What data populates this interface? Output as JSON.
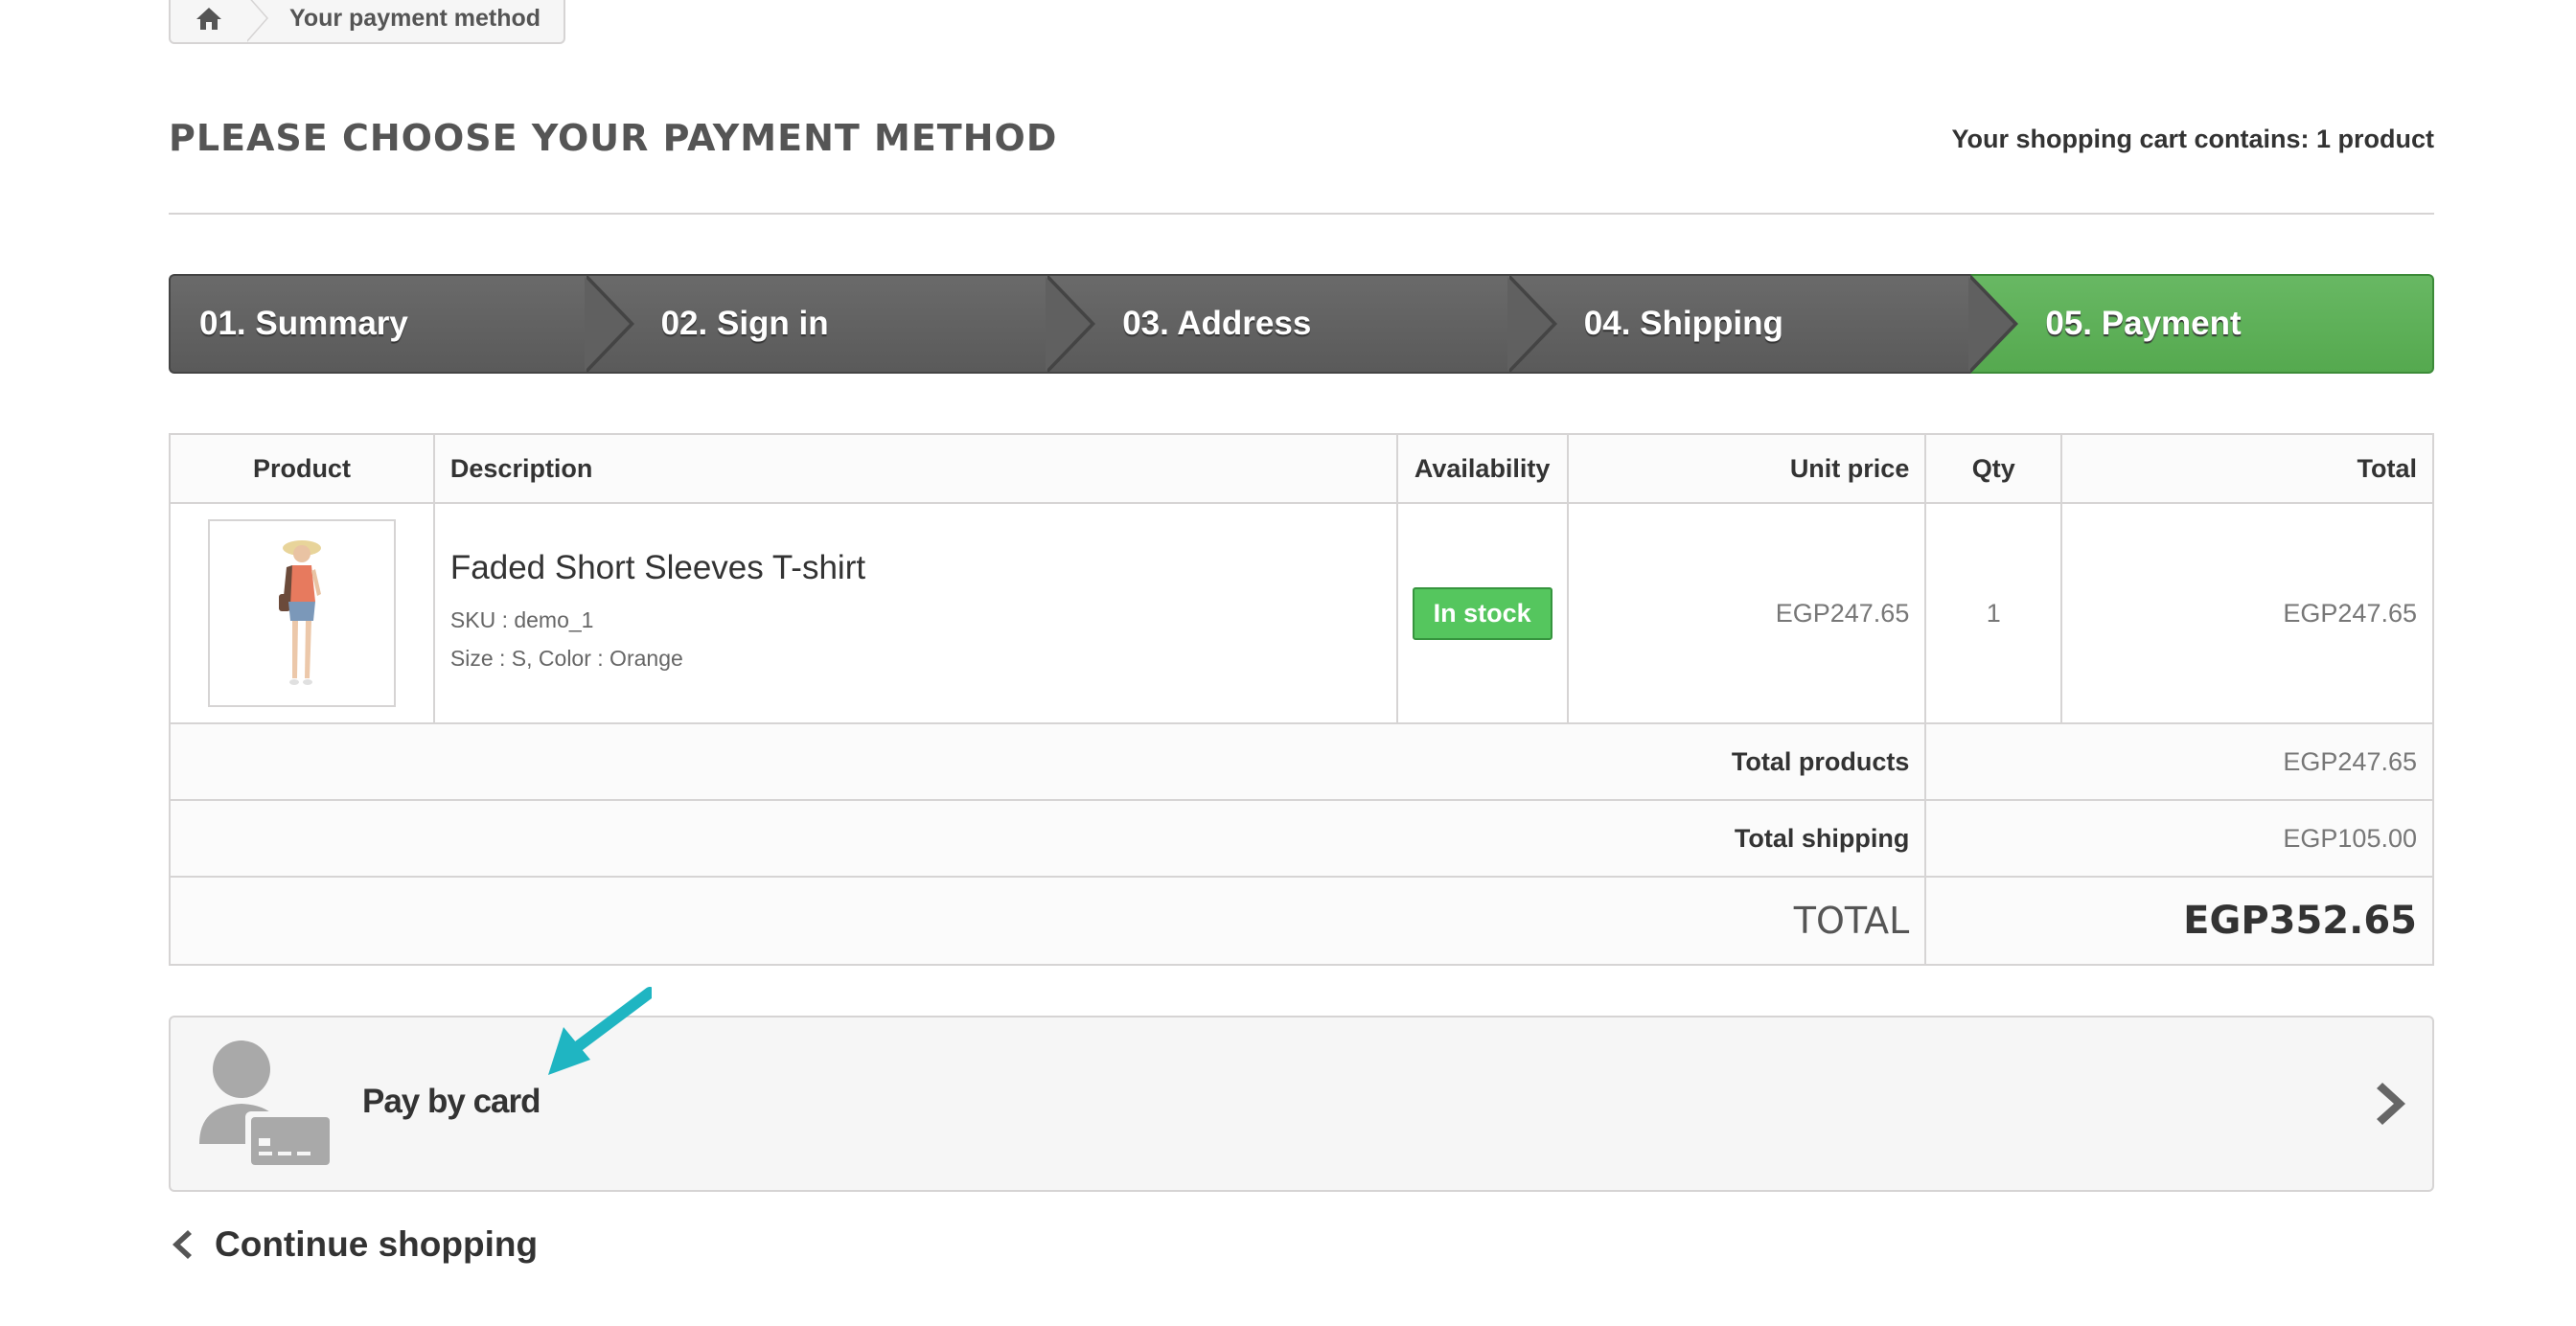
{
  "breadcrumb": {
    "home_icon": "home-icon",
    "current": "Your payment method"
  },
  "header": {
    "title": "PLEASE CHOOSE YOUR PAYMENT METHOD",
    "cart_summary": "Your shopping cart contains: 1 product"
  },
  "steps": [
    {
      "label": "01. Summary"
    },
    {
      "label": "02. Sign in"
    },
    {
      "label": "03. Address"
    },
    {
      "label": "04. Shipping"
    },
    {
      "label": "05. Payment",
      "active": true
    }
  ],
  "table": {
    "headers": {
      "product": "Product",
      "description": "Description",
      "availability": "Availability",
      "unit_price": "Unit price",
      "qty": "Qty",
      "total": "Total"
    },
    "item": {
      "name": "Faded Short Sleeves T-shirt",
      "sku": "SKU : demo_1",
      "attributes": "Size : S, Color : Orange",
      "availability": "In stock",
      "unit_price": "EGP247.65",
      "qty": "1",
      "total": "EGP247.65"
    },
    "totals": {
      "products_label": "Total products",
      "products_value": "EGP247.65",
      "shipping_label": "Total shipping",
      "shipping_value": "EGP105.00",
      "grand_label": "TOTAL",
      "grand_value": "EGP352.65"
    }
  },
  "payment": {
    "label": "Pay by card",
    "icon": "user-card-icon",
    "chevron": "chevron-right-icon"
  },
  "continue_label": "Continue shopping",
  "colors": {
    "active_step": "#5cb85c",
    "step": "#606060",
    "in_stock": "#55c65e",
    "annotation": "#1fb5c2"
  }
}
